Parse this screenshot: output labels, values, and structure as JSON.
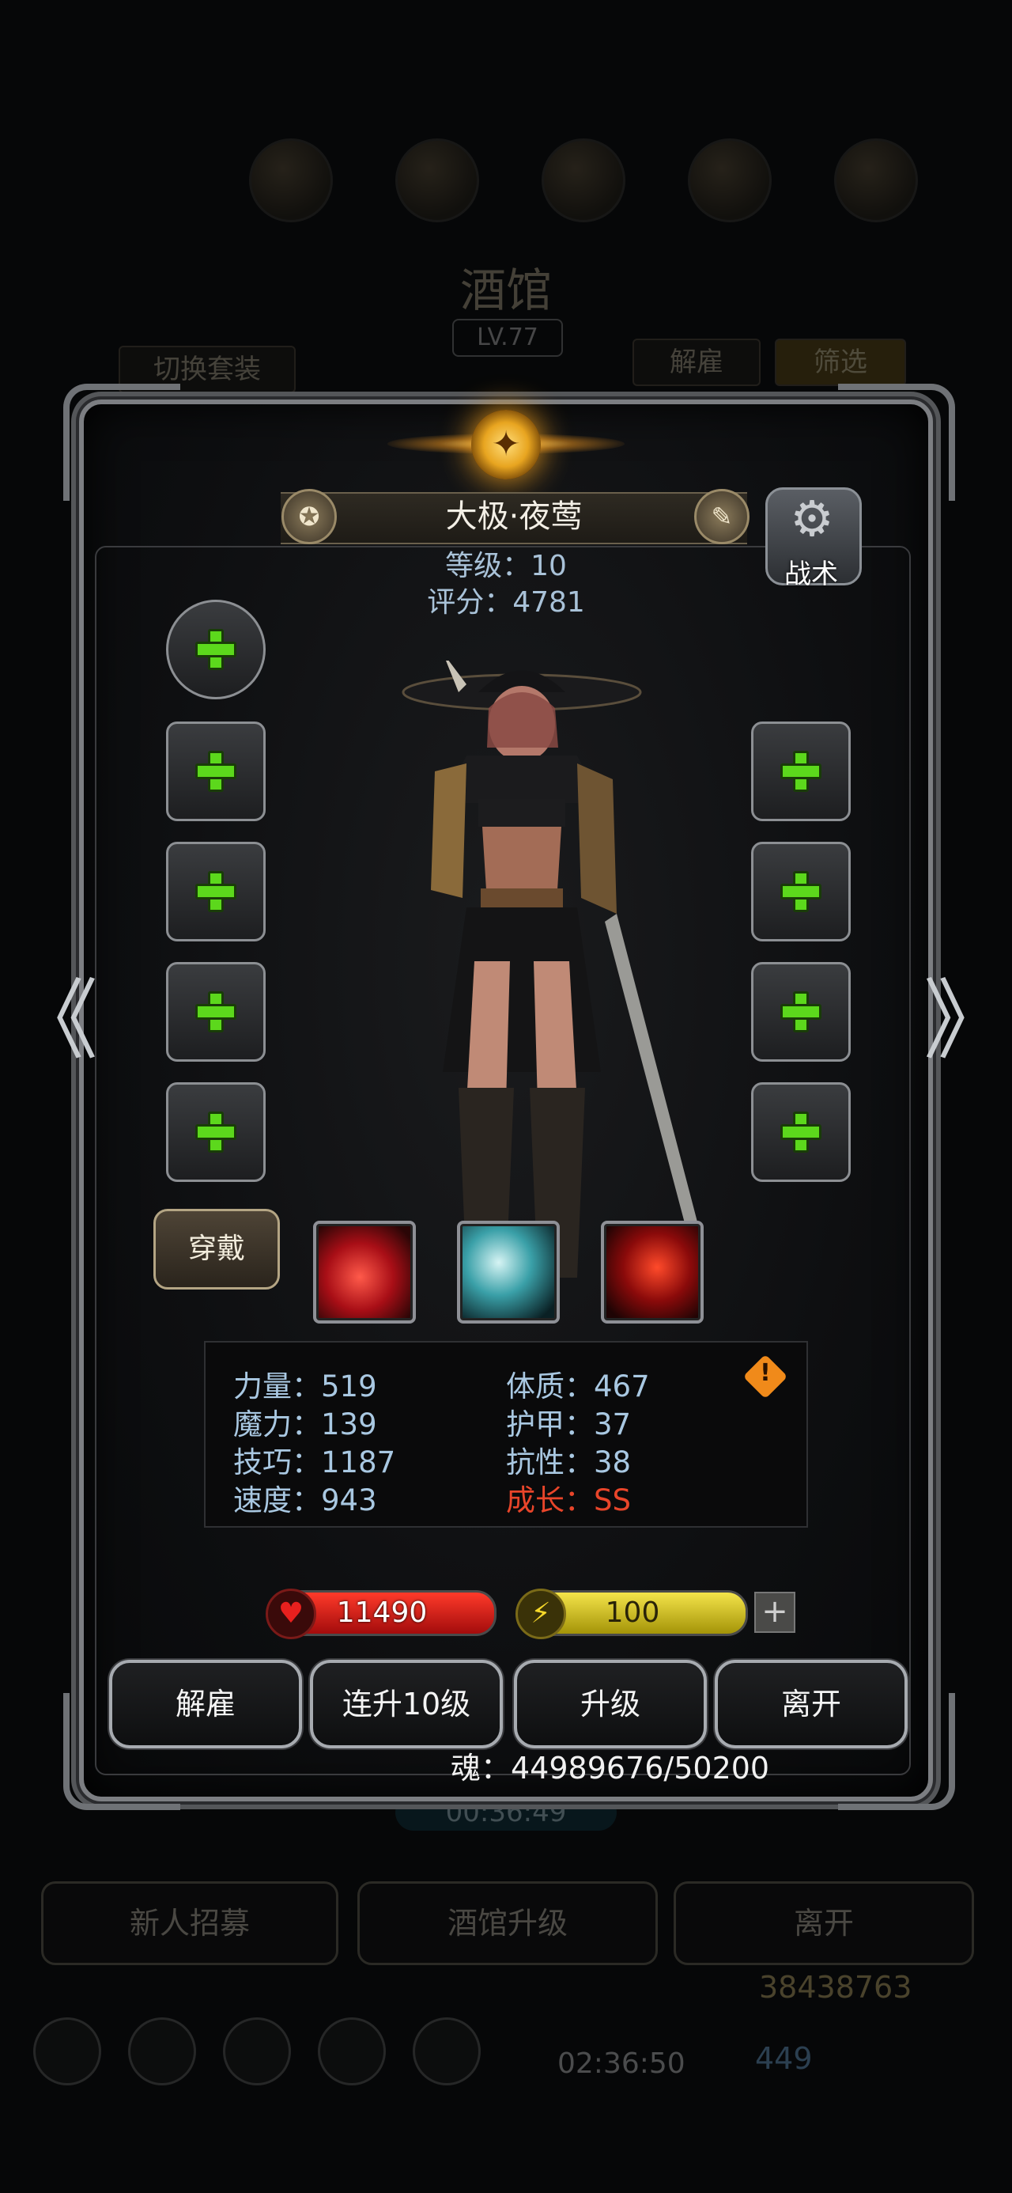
{
  "background": {
    "title": "酒馆",
    "level": "LV.77",
    "switch_set_label": "切换套装",
    "dismiss_label": "解雇",
    "filter_label": "筛选",
    "timer": "00:36:49",
    "recruit_label": "新人招募",
    "upgrade_tavern_label": "酒馆升级",
    "leave_label": "离开",
    "gold_amount": "38438763",
    "gem_amount": "449",
    "timer2": "02:36:50"
  },
  "hero": {
    "name": "大极·夜莺",
    "level_line": "等级：10",
    "score_line": "评分：4781",
    "tactic_label": "战术",
    "wear_label": "穿戴"
  },
  "stats": {
    "strength": "力量：519",
    "magic": "魔力：139",
    "skill": "技巧：1187",
    "speed": "速度：943",
    "constitution": "体质：467",
    "armor": "护甲：37",
    "resistance": "抗性：38",
    "growth": "成长：SS"
  },
  "bars": {
    "hp": "11490",
    "energy": "100",
    "add": "+"
  },
  "actions": {
    "dismiss": "解雇",
    "level_up_10": "连升10级",
    "level_up": "升级",
    "leave": "离开"
  },
  "soul": "魂：44989676/50200",
  "nav": {
    "prev": "《",
    "next": "》"
  },
  "icons": {
    "emblem": "sun-emblem-icon",
    "tactic": "gear-icon",
    "slot_add": "plus-icon"
  }
}
